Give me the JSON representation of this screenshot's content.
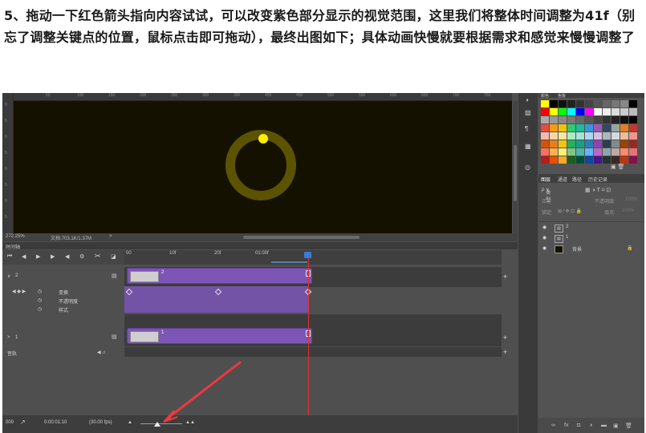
{
  "instruction": {
    "text": "5、拖动一下红色箭头指向内容试试，可以改变紫色部分显示的视觉范围，这里我们将整体时间调整为41f（别忘了调整关键点的位置，鼠标点击即可拖动），最终出图如下；具体动画快慢就要根据需求和感觉来慢慢调整了"
  },
  "ruler": {
    "top_ticks": [
      "50",
      "100",
      "150",
      "200",
      "250",
      "300",
      "350",
      "400",
      "450",
      "500",
      "550",
      "600",
      "650",
      "700",
      "750"
    ],
    "left_ticks": [
      "0",
      "5",
      "0",
      "5",
      "0",
      "5",
      "0",
      "5"
    ]
  },
  "colors": {
    "canvas_bg": "#151100",
    "ring": "#5b5300",
    "dot": "#ffee00",
    "clip": "#7d55b6",
    "playhead": "#dd3333",
    "arrow": "#f0383e"
  },
  "status": {
    "zoom": "272.25%",
    "doc": "文档:703.1K/1.37M",
    "chevron": ">"
  },
  "timeline": {
    "title": "时间轴",
    "ruler_ticks": [
      "00",
      "10f",
      "20f",
      "01:00f"
    ],
    "layers": [
      {
        "name": "2",
        "props": [
          "变换",
          "不透明度",
          "样式"
        ]
      },
      {
        "name": "1"
      }
    ],
    "audio_label": "音轨",
    "timecode": "0:00:01:10",
    "fps": "(30.00 fps)",
    "footer_left": "000"
  },
  "layers_panel": {
    "swatches_tabs": [
      "颜色",
      "色板"
    ],
    "tabs": [
      "图层",
      "通道",
      "路径",
      "历史记录"
    ],
    "kind_label": "类型",
    "blend_mode": "正常",
    "opacity_label": "不透明度:",
    "opacity_value": "100%",
    "lock_label": "锁定:",
    "fill_label": "填充:",
    "fill_value": "100%",
    "rows": [
      {
        "name": "2"
      },
      {
        "name": "1"
      },
      {
        "name": "背景"
      }
    ]
  },
  "swatches": [
    [
      "#ffff00",
      "#000000",
      "#111111",
      "#222222",
      "#333333",
      "#444444",
      "#555555",
      "#666666",
      "#777777",
      "#888888",
      "#000000"
    ],
    [
      "#ff0000",
      "#ffff00",
      "#00ff00",
      "#00ffff",
      "#0000ff",
      "#ff00ff",
      "#ffffff",
      "#eeeeee",
      "#dddddd",
      "#cccccc",
      "#bbbbbb"
    ],
    [
      "#aaaaaa",
      "#999999",
      "#888888",
      "#777777",
      "#666666",
      "#555555",
      "#444444",
      "#333333",
      "#222222",
      "#111111",
      "#000000"
    ],
    [
      "#e74c3c",
      "#f39c12",
      "#f1c40f",
      "#2ecc71",
      "#1abc9c",
      "#3498db",
      "#9b59b6",
      "#34495e",
      "#95a5a6",
      "#e67e22",
      "#c0392b"
    ],
    [
      "#f5b7b1",
      "#fad7a0",
      "#f9e79f",
      "#abebc6",
      "#a3e4d7",
      "#aed6f1",
      "#d7bde2",
      "#aeb6bf",
      "#d5dbdb",
      "#edbb99",
      "#f1948a"
    ],
    [
      "#d35400",
      "#e67e22",
      "#f1c40f",
      "#27ae60",
      "#16a085",
      "#2980b9",
      "#8e44ad",
      "#2c3e50",
      "#7f8c8d",
      "#a04000",
      "#922b21"
    ],
    [
      "#ff6f61",
      "#ffb347",
      "#fff176",
      "#81c784",
      "#4db6ac",
      "#64b5f6",
      "#ba68c8",
      "#90a4ae",
      "#bcaaa4",
      "#ff8a65",
      "#e57373"
    ],
    [
      "#b71c1c",
      "#e65100",
      "#f9a825",
      "#1b5e20",
      "#004d40",
      "#0d47a1",
      "#4a148c",
      "#263238",
      "#3e2723",
      "#bf360c",
      "#880e4f"
    ]
  ]
}
